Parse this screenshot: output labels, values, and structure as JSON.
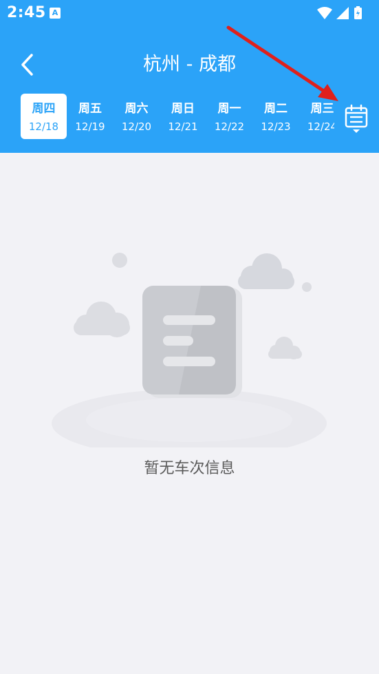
{
  "status_bar": {
    "time": "2:45",
    "notification_badge": "A"
  },
  "header": {
    "title": "杭州 - 成都",
    "background_color": "#2ba3f8"
  },
  "date_tabs": [
    {
      "weekday": "周四",
      "date": "12/18",
      "selected": true
    },
    {
      "weekday": "周五",
      "date": "12/19",
      "selected": false
    },
    {
      "weekday": "周六",
      "date": "12/20",
      "selected": false
    },
    {
      "weekday": "周日",
      "date": "12/21",
      "selected": false
    },
    {
      "weekday": "周一",
      "date": "12/22",
      "selected": false
    },
    {
      "weekday": "周二",
      "date": "12/23",
      "selected": false
    },
    {
      "weekday": "周三",
      "date": "12/24",
      "selected": false
    }
  ],
  "calendar_button": {
    "icon": "calendar-icon"
  },
  "empty_state": {
    "message": "暂无车次信息",
    "icon": "empty-document-illustration"
  },
  "annotation": {
    "color": "#e0201b",
    "points_to": "calendar-button"
  }
}
